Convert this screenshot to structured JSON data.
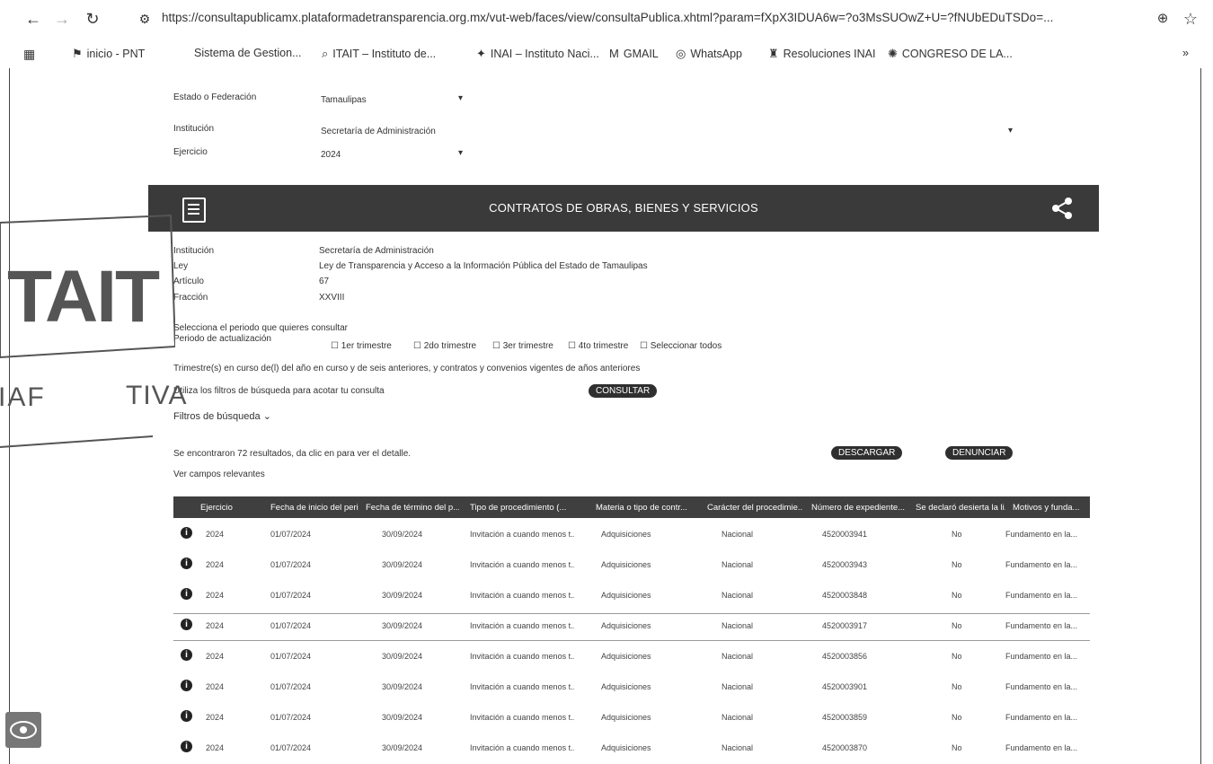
{
  "browser": {
    "url": "https://consultapublicamx.plataformadetransparencia.org.mx/vut-web/faces/view/consultaPublica.xhtml?param=fXpX3IDUA6w=?o3MsSUOwZ+U=?fNUbEDuTSDo=...",
    "bookmarks": [
      {
        "icon": "pnt-icon",
        "label": "inicio - PNT"
      },
      {
        "icon": "",
        "label": "Sistema de Gestion..."
      },
      {
        "icon": "search-icon",
        "label": "ITAIT – Instituto de..."
      },
      {
        "icon": "inai-icon",
        "label": "INAI – Instituto Naci..."
      },
      {
        "icon": "gmail-icon",
        "label": "GMAIL"
      },
      {
        "icon": "whatsapp-icon",
        "label": "WhatsApp"
      },
      {
        "icon": "resoluciones-icon",
        "label": "Resoluciones INAI"
      },
      {
        "icon": "congreso-icon",
        "label": "CONGRESO DE LA..."
      }
    ],
    "more": "»"
  },
  "filters": {
    "estado_label": "Estado o Federación",
    "estado_value": "Tamaulipas",
    "institucion_label": "Institución",
    "institucion_value": "Secretaría de Administración",
    "ejercicio_label": "Ejercicio",
    "ejercicio_value": "2024"
  },
  "header": {
    "title": "CONTRATOS DE OBRAS, BIENES Y SERVICIOS"
  },
  "info": {
    "rows": [
      {
        "label": "Institución",
        "value": "Secretaría de Administración"
      },
      {
        "label": "Ley",
        "value": "Ley de Transparencia y Acceso a la Información Pública del Estado de Tamaulipas"
      },
      {
        "label": "Artículo",
        "value": "67"
      },
      {
        "label": "Fracción",
        "value": "XXVIII"
      }
    ],
    "periodo_prompt": "Selecciona el periodo que quieres consultar",
    "periodo_label": "Periodo de actualización",
    "periodos": [
      "1er trimestre",
      "2do trimestre",
      "3er trimestre",
      "4to trimestre",
      "Seleccionar todos"
    ],
    "note": "Trimestre(s) en curso de(l) del año en curso y de seis anteriores, y contratos y convenios vigentes de años anteriores",
    "filters_prompt": "Utiliza los filtros de búsqueda para acotar tu consulta",
    "filtros_label": "Filtros de búsqueda",
    "consultar": "CONSULTAR",
    "results": "Se encontraron 72 resultados, da clic en  para ver el detalle.",
    "info_icon": "i",
    "descargar": "DESCARGAR",
    "denunciar": "DENUNCIAR",
    "campos": "Ver campos relevantes"
  },
  "stamp": {
    "tait": "TAIT",
    "iaf": "IAF",
    "tiva": "TIVA"
  },
  "table": {
    "headers": [
      "Ejercicio",
      "Fecha de inicio del peri...",
      "Fecha de término del p...",
      "Tipo de procedimiento (...",
      "Materia o tipo de contr...",
      "Carácter del procedimie...",
      "Número de expediente...",
      "Se declaró desierta la li...",
      "Motivos y funda..."
    ],
    "rows": [
      [
        "2024",
        "01/07/2024",
        "30/09/2024",
        "Invitación a cuando menos t...",
        "Adquisiciones",
        "Nacional",
        "4520003941",
        "No",
        "Fundamento en la..."
      ],
      [
        "2024",
        "01/07/2024",
        "30/09/2024",
        "Invitación a cuando menos t...",
        "Adquisiciones",
        "Nacional",
        "4520003943",
        "No",
        "Fundamento en la..."
      ],
      [
        "2024",
        "01/07/2024",
        "30/09/2024",
        "Invitación a cuando menos t...",
        "Adquisiciones",
        "Nacional",
        "4520003848",
        "No",
        "Fundamento en la..."
      ],
      [
        "2024",
        "01/07/2024",
        "30/09/2024",
        "Invitación a cuando menos t...",
        "Adquisiciones",
        "Nacional",
        "4520003917",
        "No",
        "Fundamento en la..."
      ],
      [
        "2024",
        "01/07/2024",
        "30/09/2024",
        "Invitación a cuando menos t...",
        "Adquisiciones",
        "Nacional",
        "4520003856",
        "No",
        "Fundamento en la..."
      ],
      [
        "2024",
        "01/07/2024",
        "30/09/2024",
        "Invitación a cuando menos t...",
        "Adquisiciones",
        "Nacional",
        "4520003901",
        "No",
        "Fundamento en la..."
      ],
      [
        "2024",
        "01/07/2024",
        "30/09/2024",
        "Invitación a cuando menos t...",
        "Adquisiciones",
        "Nacional",
        "4520003859",
        "No",
        "Fundamento en la..."
      ],
      [
        "2024",
        "01/07/2024",
        "30/09/2024",
        "Invitación a cuando menos t...",
        "Adquisiciones",
        "Nacional",
        "4520003870",
        "No",
        "Fundamento en la..."
      ]
    ]
  }
}
